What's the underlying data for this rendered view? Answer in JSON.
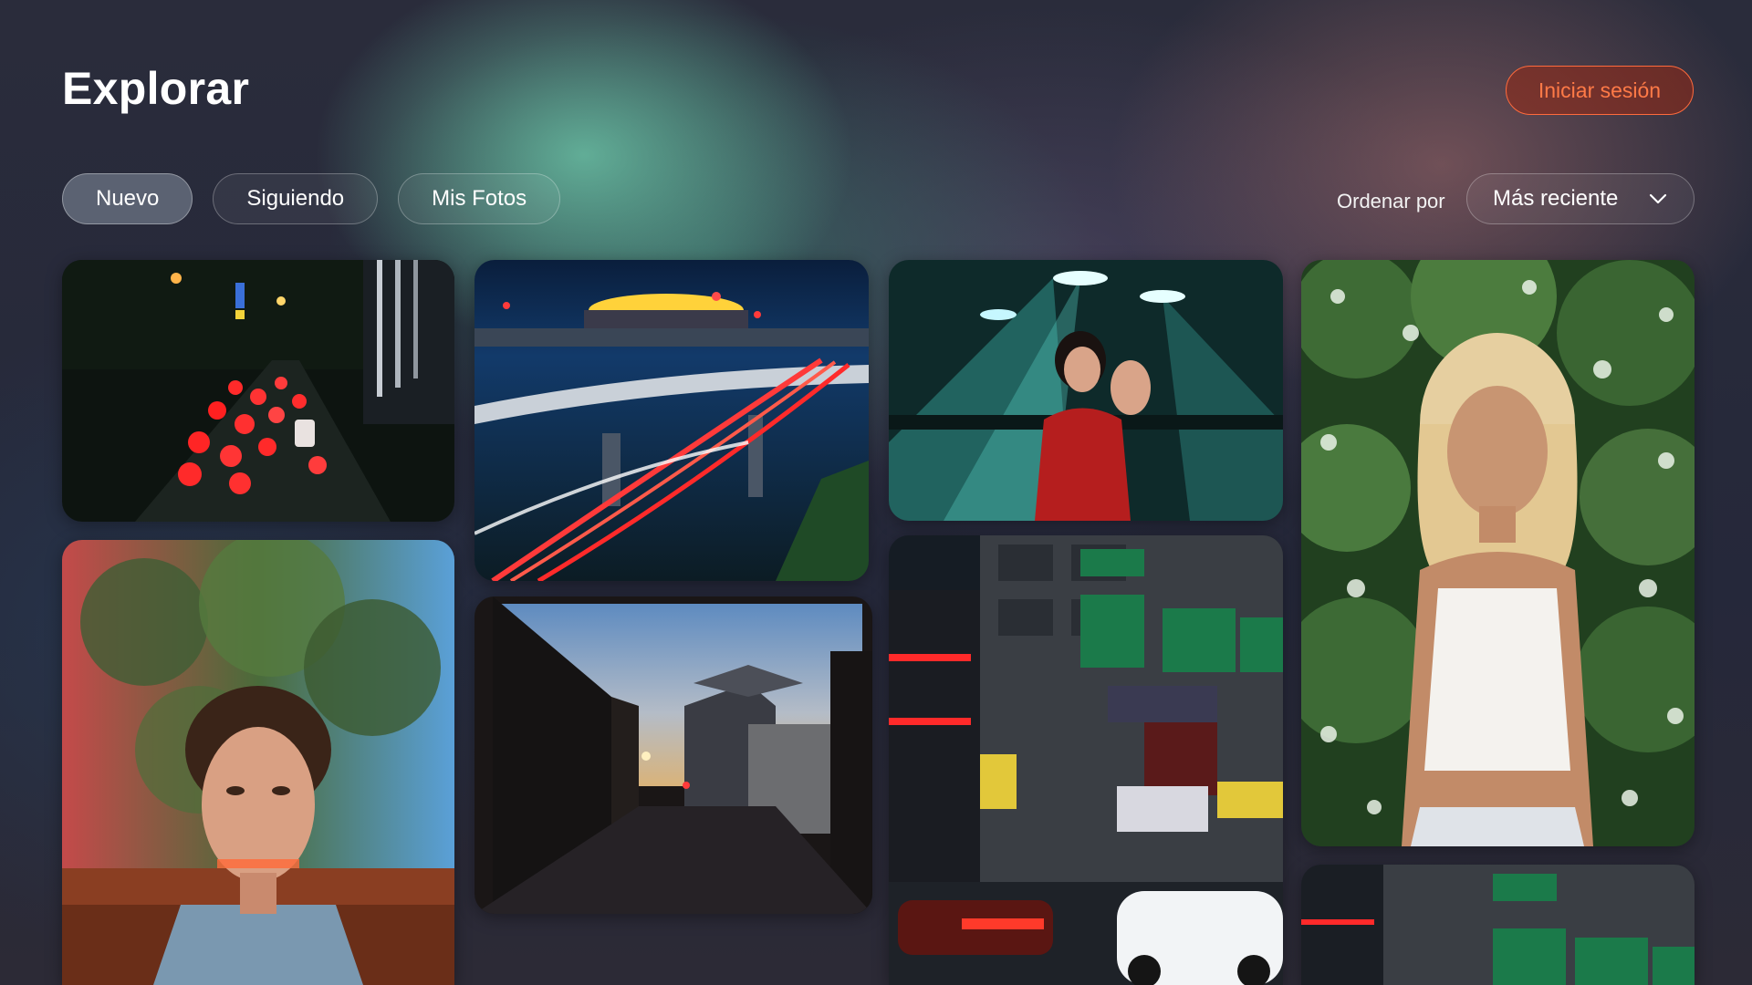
{
  "header": {
    "title": "Explorar",
    "login_label": "Iniciar sesión"
  },
  "filters": {
    "tabs": [
      {
        "label": "Nuevo",
        "active": true
      },
      {
        "label": "Siguiendo",
        "active": false
      },
      {
        "label": "Mis Fotos",
        "active": false
      }
    ]
  },
  "sort": {
    "label": "Ordenar por",
    "selected": "Más reciente"
  },
  "colors": {
    "accent": "#ff6a3c",
    "text": "#ffffff"
  },
  "icons": {
    "sort_dropdown": "chevron-down-icon"
  },
  "photos": [
    {
      "name": "night-traffic-street-photo"
    },
    {
      "name": "highway-light-trails-photo"
    },
    {
      "name": "woman-in-red-photo"
    },
    {
      "name": "blonde-woman-portrait-photo"
    },
    {
      "name": "curly-hair-man-portrait-photo"
    },
    {
      "name": "dusk-alley-photo"
    },
    {
      "name": "seoul-night-street-photo"
    },
    {
      "name": "seoul-street-sign-photo"
    }
  ]
}
